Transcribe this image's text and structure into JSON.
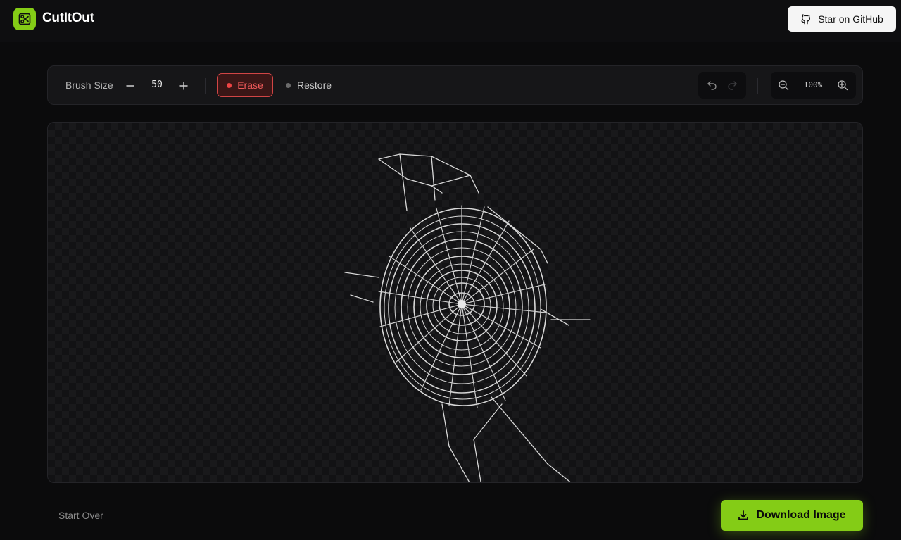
{
  "app": {
    "name": "CutItOut",
    "github_label": "Star on GitHub"
  },
  "toolbar": {
    "brush_label": "Brush Size",
    "brush_value": "50",
    "erase_label": "Erase",
    "restore_label": "Restore",
    "zoom_value": "100%"
  },
  "footer": {
    "start_over_label": "Start Over",
    "download_label": "Download Image"
  },
  "colors": {
    "accent": "#84cc16",
    "erase": "#ef4444",
    "background": "#0b0b0c"
  },
  "icons": {
    "logo": "scissors-icon",
    "github": "github-icon",
    "undo": "undo-icon",
    "redo": "redo-icon",
    "zoom_out": "zoom-out-icon",
    "zoom_in": "zoom-in-icon",
    "download": "download-icon"
  }
}
